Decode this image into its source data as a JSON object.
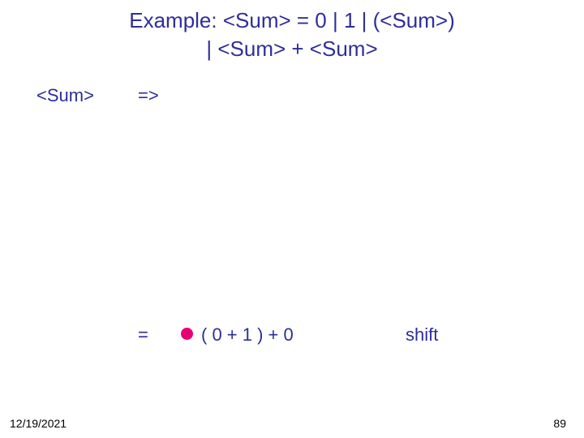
{
  "title_line1": "Example: <Sum> = 0 | 1 | (<Sum>)",
  "title_line2": "| <Sum> + <Sum>",
  "derivation": {
    "lhs": "<Sum>",
    "arrow": "=>",
    "eq": "=",
    "expr": "( 0 + 1 ) + 0",
    "action": "shift"
  },
  "footer": {
    "date": "12/19/2021",
    "page": "89"
  },
  "colors": {
    "text": "#2e2e99",
    "bullet": "#e60073"
  }
}
